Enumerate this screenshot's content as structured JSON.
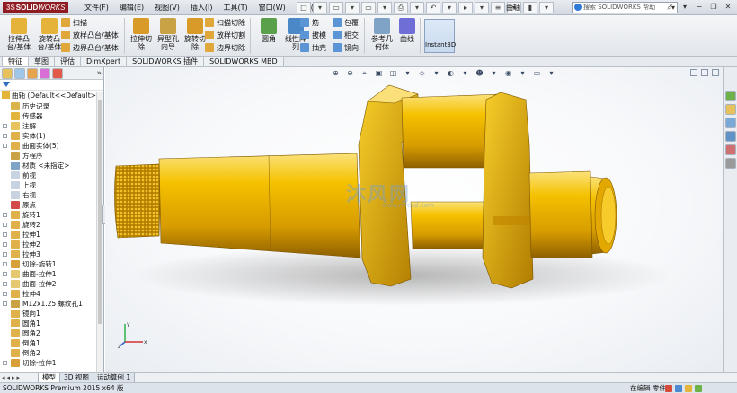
{
  "titlebar": {
    "logo_ds": "3S",
    "logo_solid": "SOLID",
    "logo_works": "WORKS",
    "menu": [
      "文件(F)",
      "编辑(E)",
      "视图(V)",
      "插入(I)",
      "工具(T)",
      "窗口(W)",
      "帮助(H)"
    ],
    "quick_access": [
      "□",
      "▾",
      "▭",
      "▾",
      "▭",
      "▾",
      "⎙",
      "▾",
      "↶",
      "▾",
      "▸",
      "▾",
      "≡",
      "▾",
      "▮",
      "▾"
    ],
    "document_title": "曲轴",
    "search_placeholder": "搜索 SOLIDWORKS 帮助",
    "window_controls": [
      "?",
      "▾",
      "−",
      "❐",
      "✕"
    ]
  },
  "command_manager": {
    "big_buttons": [
      {
        "label": "拉伸凸\n台/基体",
        "icon": "extrude-boss-icon"
      },
      {
        "label": "旋转凸\n台/基体",
        "icon": "revolve-boss-icon"
      },
      {
        "label": "拉伸切\n除",
        "icon": "extrude-cut-icon"
      },
      {
        "label": "异型孔\n向导",
        "icon": "hole-wizard-icon"
      },
      {
        "label": "旋转切\n除",
        "icon": "revolve-cut-icon"
      },
      {
        "label": "圆角",
        "icon": "fillet-icon"
      },
      {
        "label": "线性阵\n列",
        "icon": "linear-pattern-icon"
      },
      {
        "label": "参考几\n何体",
        "icon": "reference-geometry-icon"
      },
      {
        "label": "曲线",
        "icon": "curves-icon"
      }
    ],
    "small_buttons": [
      {
        "label": "扫描",
        "icon": "sweep-icon"
      },
      {
        "label": "放样凸台/基体",
        "icon": "loft-boss-icon"
      },
      {
        "label": "边界凸台/基体",
        "icon": "boundary-boss-icon"
      },
      {
        "label": "扫描切除",
        "icon": "swept-cut-icon"
      },
      {
        "label": "放样切割",
        "icon": "lofted-cut-icon"
      },
      {
        "label": "边界切除",
        "icon": "boundary-cut-icon"
      },
      {
        "label": "筋",
        "icon": "rib-icon"
      },
      {
        "label": "拔模",
        "icon": "draft-icon"
      },
      {
        "label": "抽壳",
        "icon": "shell-icon"
      },
      {
        "label": "包覆",
        "icon": "wrap-icon"
      },
      {
        "label": "相交",
        "icon": "intersect-icon"
      },
      {
        "label": "镜向",
        "icon": "mirror-icon"
      }
    ],
    "instant3d_label": "Instant3D"
  },
  "tabs": [
    "特征",
    "草图",
    "评估",
    "DimXpert",
    "SOLIDWORKS 插件",
    "SOLIDWORKS MBD"
  ],
  "active_tab": 0,
  "feature_tree": {
    "root": "曲轴  (Default<<Default>_",
    "items": [
      {
        "label": "历史记录",
        "icon": "history-icon",
        "expandable": false,
        "color": "#d8b44a"
      },
      {
        "label": "传感器",
        "icon": "sensor-icon",
        "expandable": false,
        "color": "#e3b53d"
      },
      {
        "label": "注解",
        "icon": "annotation-icon",
        "expandable": true,
        "color": "#e6c35c"
      },
      {
        "label": "实体(1)",
        "icon": "solid-body-icon",
        "expandable": true,
        "color": "#e0b04a"
      },
      {
        "label": "曲面实体(5)",
        "icon": "surface-body-icon",
        "expandable": true,
        "color": "#e0b04a"
      },
      {
        "label": "方程序",
        "icon": "equation-icon",
        "expandable": false,
        "color": "#c9a246"
      },
      {
        "label": "材质 <未指定>",
        "icon": "material-icon",
        "expandable": false,
        "color": "#7fa3c7"
      },
      {
        "label": "前视",
        "icon": "plane-icon",
        "expandable": false,
        "color": "#c7d3e0"
      },
      {
        "label": "上视",
        "icon": "plane-icon",
        "expandable": false,
        "color": "#c7d3e0"
      },
      {
        "label": "右视",
        "icon": "plane-icon",
        "expandable": false,
        "color": "#c7d3e0"
      },
      {
        "label": "原点",
        "icon": "origin-icon",
        "expandable": false,
        "color": "#d24a4a"
      },
      {
        "label": "旋转1",
        "icon": "revolve-feature-icon",
        "expandable": true,
        "color": "#e0b04a"
      },
      {
        "label": "旋转2",
        "icon": "revolve-feature-icon",
        "expandable": true,
        "color": "#e0b04a"
      },
      {
        "label": "拉伸1",
        "icon": "extrude-feature-icon",
        "expandable": true,
        "color": "#e0b04a"
      },
      {
        "label": "拉伸2",
        "icon": "extrude-feature-icon",
        "expandable": true,
        "color": "#e0b04a"
      },
      {
        "label": "拉伸3",
        "icon": "extrude-feature-icon",
        "expandable": true,
        "color": "#e0b04a"
      },
      {
        "label": "切除-旋转1",
        "icon": "cut-revolve-feature-icon",
        "expandable": true,
        "color": "#d8a03a"
      },
      {
        "label": "曲面-拉伸1",
        "icon": "surface-extrude-icon",
        "expandable": true,
        "color": "#e6c870"
      },
      {
        "label": "曲面-拉伸2",
        "icon": "surface-extrude-icon",
        "expandable": true,
        "color": "#e6c870"
      },
      {
        "label": "拉伸4",
        "icon": "extrude-feature-icon",
        "expandable": true,
        "color": "#e0b04a"
      },
      {
        "label": "M12x1.25 螺纹孔1",
        "icon": "tapped-hole-icon",
        "expandable": true,
        "color": "#c9a246"
      },
      {
        "label": "镜向1",
        "icon": "mirror-feature-icon",
        "expandable": false,
        "color": "#e0b04a"
      },
      {
        "label": "圆角1",
        "icon": "fillet-feature-icon",
        "expandable": false,
        "color": "#e0b04a"
      },
      {
        "label": "圆角2",
        "icon": "fillet-feature-icon",
        "expandable": false,
        "color": "#e0b04a"
      },
      {
        "label": "倒角1",
        "icon": "chamfer-feature-icon",
        "expandable": false,
        "color": "#e0b04a"
      },
      {
        "label": "倒角2",
        "icon": "chamfer-feature-icon",
        "expandable": false,
        "color": "#e0b04a"
      },
      {
        "label": "切除-拉伸1",
        "icon": "cut-extrude-feature-icon",
        "expandable": true,
        "color": "#d8a03a"
      }
    ]
  },
  "viewport": {
    "hud_buttons": [
      "⊕",
      "⊖",
      "⌖",
      "▣",
      "◫",
      "▾",
      "◇",
      "▾",
      "◐",
      "▾",
      "☻",
      "▾",
      "◉",
      "▾",
      "▭",
      "▾"
    ],
    "watermark_text": "沐风网",
    "watermark_url": "www.mfcad.com",
    "triad_labels": [
      "y",
      "x",
      "z"
    ],
    "part_color": "#f2b600"
  },
  "bottom": {
    "nav_arrows": [
      "◂",
      "◂",
      "▸",
      "▸"
    ],
    "tabs": [
      "模型",
      "3D 视图",
      "运动算例 1"
    ],
    "active_tab": 0,
    "status_left": "SOLIDWORKS Premium 2015 x64 版",
    "status_right": "在编辑 零件"
  }
}
